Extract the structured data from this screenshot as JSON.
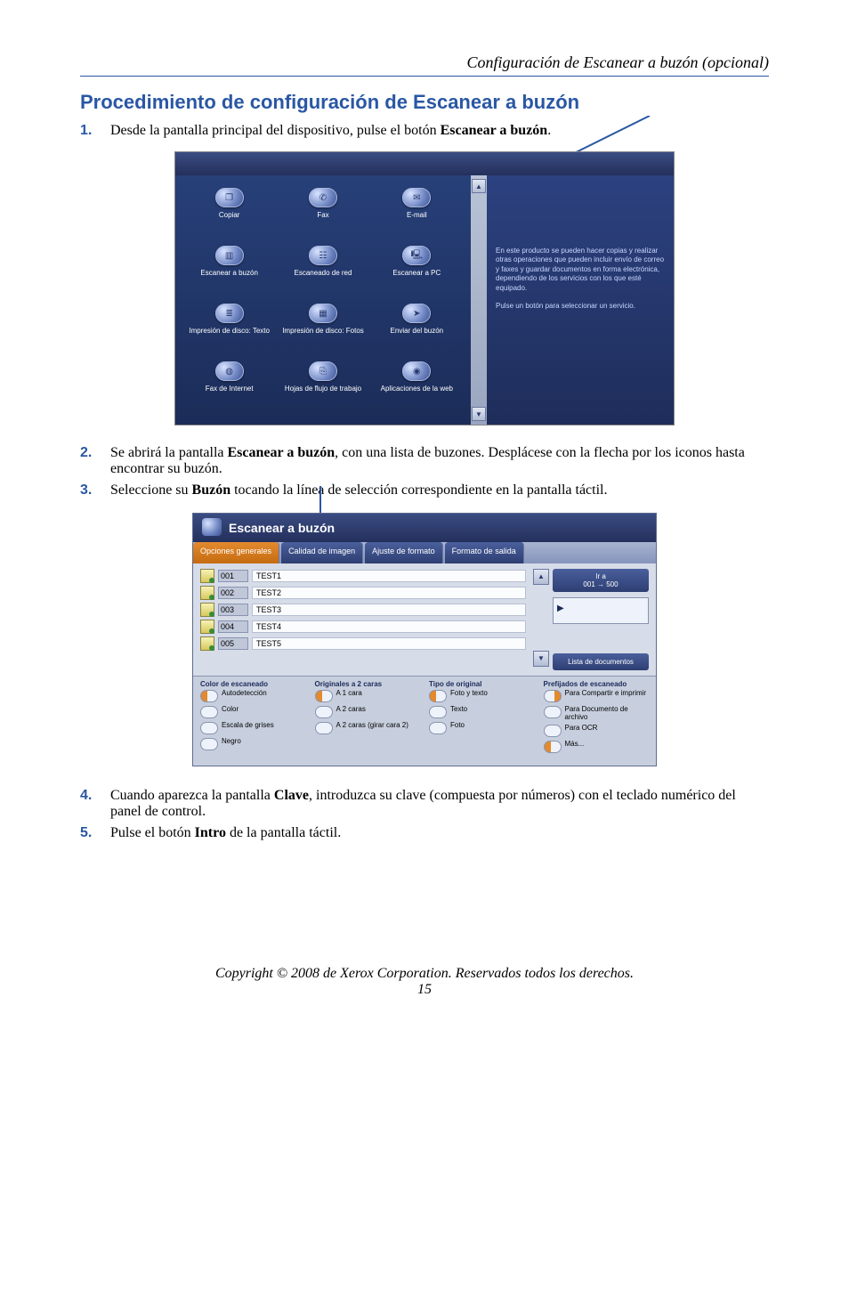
{
  "header": {
    "section_title": "Configuración de Escanear a buzón (opcional)"
  },
  "title": "Procedimiento de configuración de Escanear a buzón",
  "steps": {
    "s1": {
      "num": "1.",
      "pre": "Desde la pantalla principal del dispositivo, pulse el botón ",
      "bold": "Escanear a buzón",
      "post": "."
    },
    "s2": {
      "num": "2.",
      "pre": "Se abrirá la pantalla ",
      "bold": "Escanear a buzón",
      "post": ", con una lista de buzones. Desplácese con la flecha por los iconos hasta encontrar su buzón."
    },
    "s3": {
      "num": "3.",
      "pre": "Seleccione su ",
      "bold": "Buzón",
      "post": " tocando la línea de selección correspondiente en la pantalla táctil."
    },
    "s4": {
      "num": "4.",
      "pre": "Cuando aparezca la pantalla ",
      "bold": "Clave",
      "post": ", introduzca su clave (compuesta por números) con el teclado numérico del panel de control."
    },
    "s5": {
      "num": "5.",
      "pre": "Pulse el botón ",
      "bold": "Intro",
      "post": " de la pantalla táctil."
    }
  },
  "shot1": {
    "cells": [
      "Copiar",
      "Fax",
      "E-mail",
      "Escanear a buzón",
      "Escaneado de red",
      "Escanear a PC",
      "Impresión de disco: Texto",
      "Impresión de disco: Fotos",
      "Enviar del buzón",
      "Fax de Internet",
      "Hojas de flujo de trabajo",
      "Aplicaciones de la web"
    ],
    "info1": "En este producto se pueden hacer copias y realizar otras operaciones que pueden incluir envío de correo y faxes y guardar documentos en forma electrónica, dependiendo de los servicios con los que esté equipado.",
    "info2": "Pulse un botón para seleccionar un servicio."
  },
  "shot2": {
    "title": "Escanear a buzón",
    "tabs": [
      "Opciones generales",
      "Calidad de imagen",
      "Ajuste de formato",
      "Formato de salida"
    ],
    "rows": [
      {
        "code": "001",
        "name": "TEST1"
      },
      {
        "code": "002",
        "name": "TEST2"
      },
      {
        "code": "003",
        "name": "TEST3"
      },
      {
        "code": "004",
        "name": "TEST4"
      },
      {
        "code": "005",
        "name": "TEST5"
      }
    ],
    "side": {
      "ira_label": "Ir a",
      "ira_range": "001 → 500",
      "list_btn": "Lista de documentos"
    },
    "opts": {
      "col1": {
        "hdr": "Color de escaneado",
        "items": [
          "Autodetección",
          "Color",
          "Escala de grises",
          "Negro"
        ]
      },
      "col2": {
        "hdr": "Originales a 2 caras",
        "items": [
          "A 1 cara",
          "A 2 caras",
          "A 2 caras (girar cara 2)"
        ]
      },
      "col3": {
        "hdr": "Tipo de original",
        "items": [
          "Foto y texto",
          "Texto",
          "Foto"
        ]
      },
      "col4": {
        "hdr": "Prefijados de escaneado",
        "items": [
          "Para Compartir e imprimir",
          "Para Documento de archivo",
          "Para OCR",
          "Más..."
        ]
      }
    }
  },
  "footer": {
    "copyright": "Copyright © 2008 de Xerox Corporation. Reservados todos los derechos.",
    "page": "15"
  }
}
